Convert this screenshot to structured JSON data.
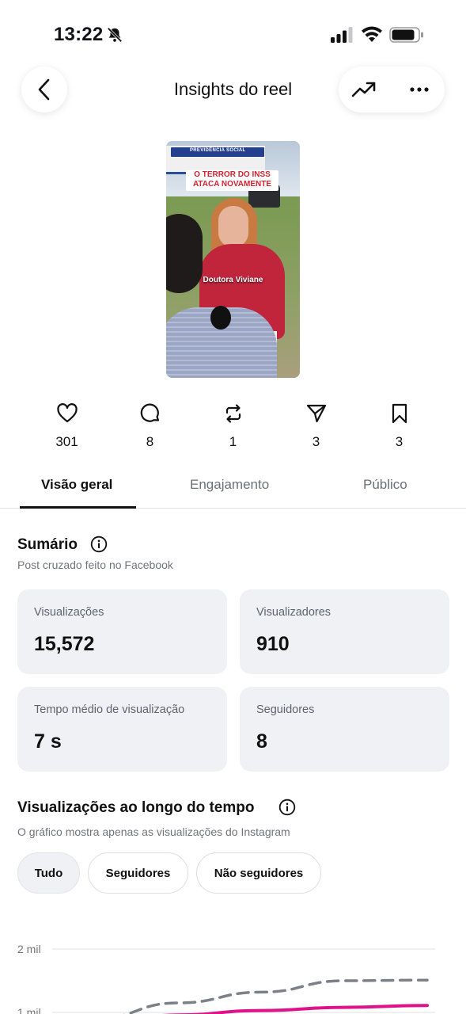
{
  "status": {
    "time": "13:22"
  },
  "header": {
    "title": "Insights do reel"
  },
  "thumbnail": {
    "banner_line1": "O TERROR DO INSS",
    "banner_line2": "ATACA NOVAMENTE",
    "caption": "Doutora Viviane",
    "sign_text": "PREVIDÊNCIA SOCIAL"
  },
  "stats": [
    {
      "icon": "heart-icon",
      "value": "301"
    },
    {
      "icon": "comment-icon",
      "value": "8"
    },
    {
      "icon": "repost-icon",
      "value": "1"
    },
    {
      "icon": "share-icon",
      "value": "3"
    },
    {
      "icon": "bookmark-icon",
      "value": "3"
    }
  ],
  "tabs": [
    {
      "label": "Visão geral",
      "active": true
    },
    {
      "label": "Engajamento",
      "active": false
    },
    {
      "label": "Público",
      "active": false
    }
  ],
  "summary": {
    "title": "Sumário",
    "subtitle": "Post cruzado feito no Facebook",
    "cards": [
      {
        "label": "Visualizações",
        "value": "15,572"
      },
      {
        "label": "Visualizadores",
        "value": "910"
      },
      {
        "label": "Tempo médio de visualização",
        "value": "7 s"
      },
      {
        "label": "Seguidores",
        "value": "8"
      }
    ]
  },
  "views_over_time": {
    "title": "Visualizações ao longo do tempo",
    "subtitle": "O gráfico mostra apenas as visualizações do Instagram",
    "filters": [
      {
        "label": "Tudo",
        "selected": true
      },
      {
        "label": "Seguidores",
        "selected": false
      },
      {
        "label": "Não seguidores",
        "selected": false
      }
    ]
  },
  "chart_data": {
    "type": "line",
    "y_tick_labels": [
      "2 mil",
      "1 mil"
    ],
    "series": [
      {
        "style": "dashed",
        "color": "#7c8088",
        "values": [
          900,
          1150,
          1320,
          1500,
          1510
        ]
      },
      {
        "style": "solid",
        "color": "#e0128a",
        "values": [
          800,
          960,
          1030,
          1080,
          1110
        ]
      }
    ],
    "colors": {
      "dashed_series": "#7c8088",
      "solid_series": "#e0128a"
    }
  },
  "colors": {
    "card_bg": "#eff1f4",
    "text_primary": "#111418",
    "text_secondary": "#70757b"
  }
}
